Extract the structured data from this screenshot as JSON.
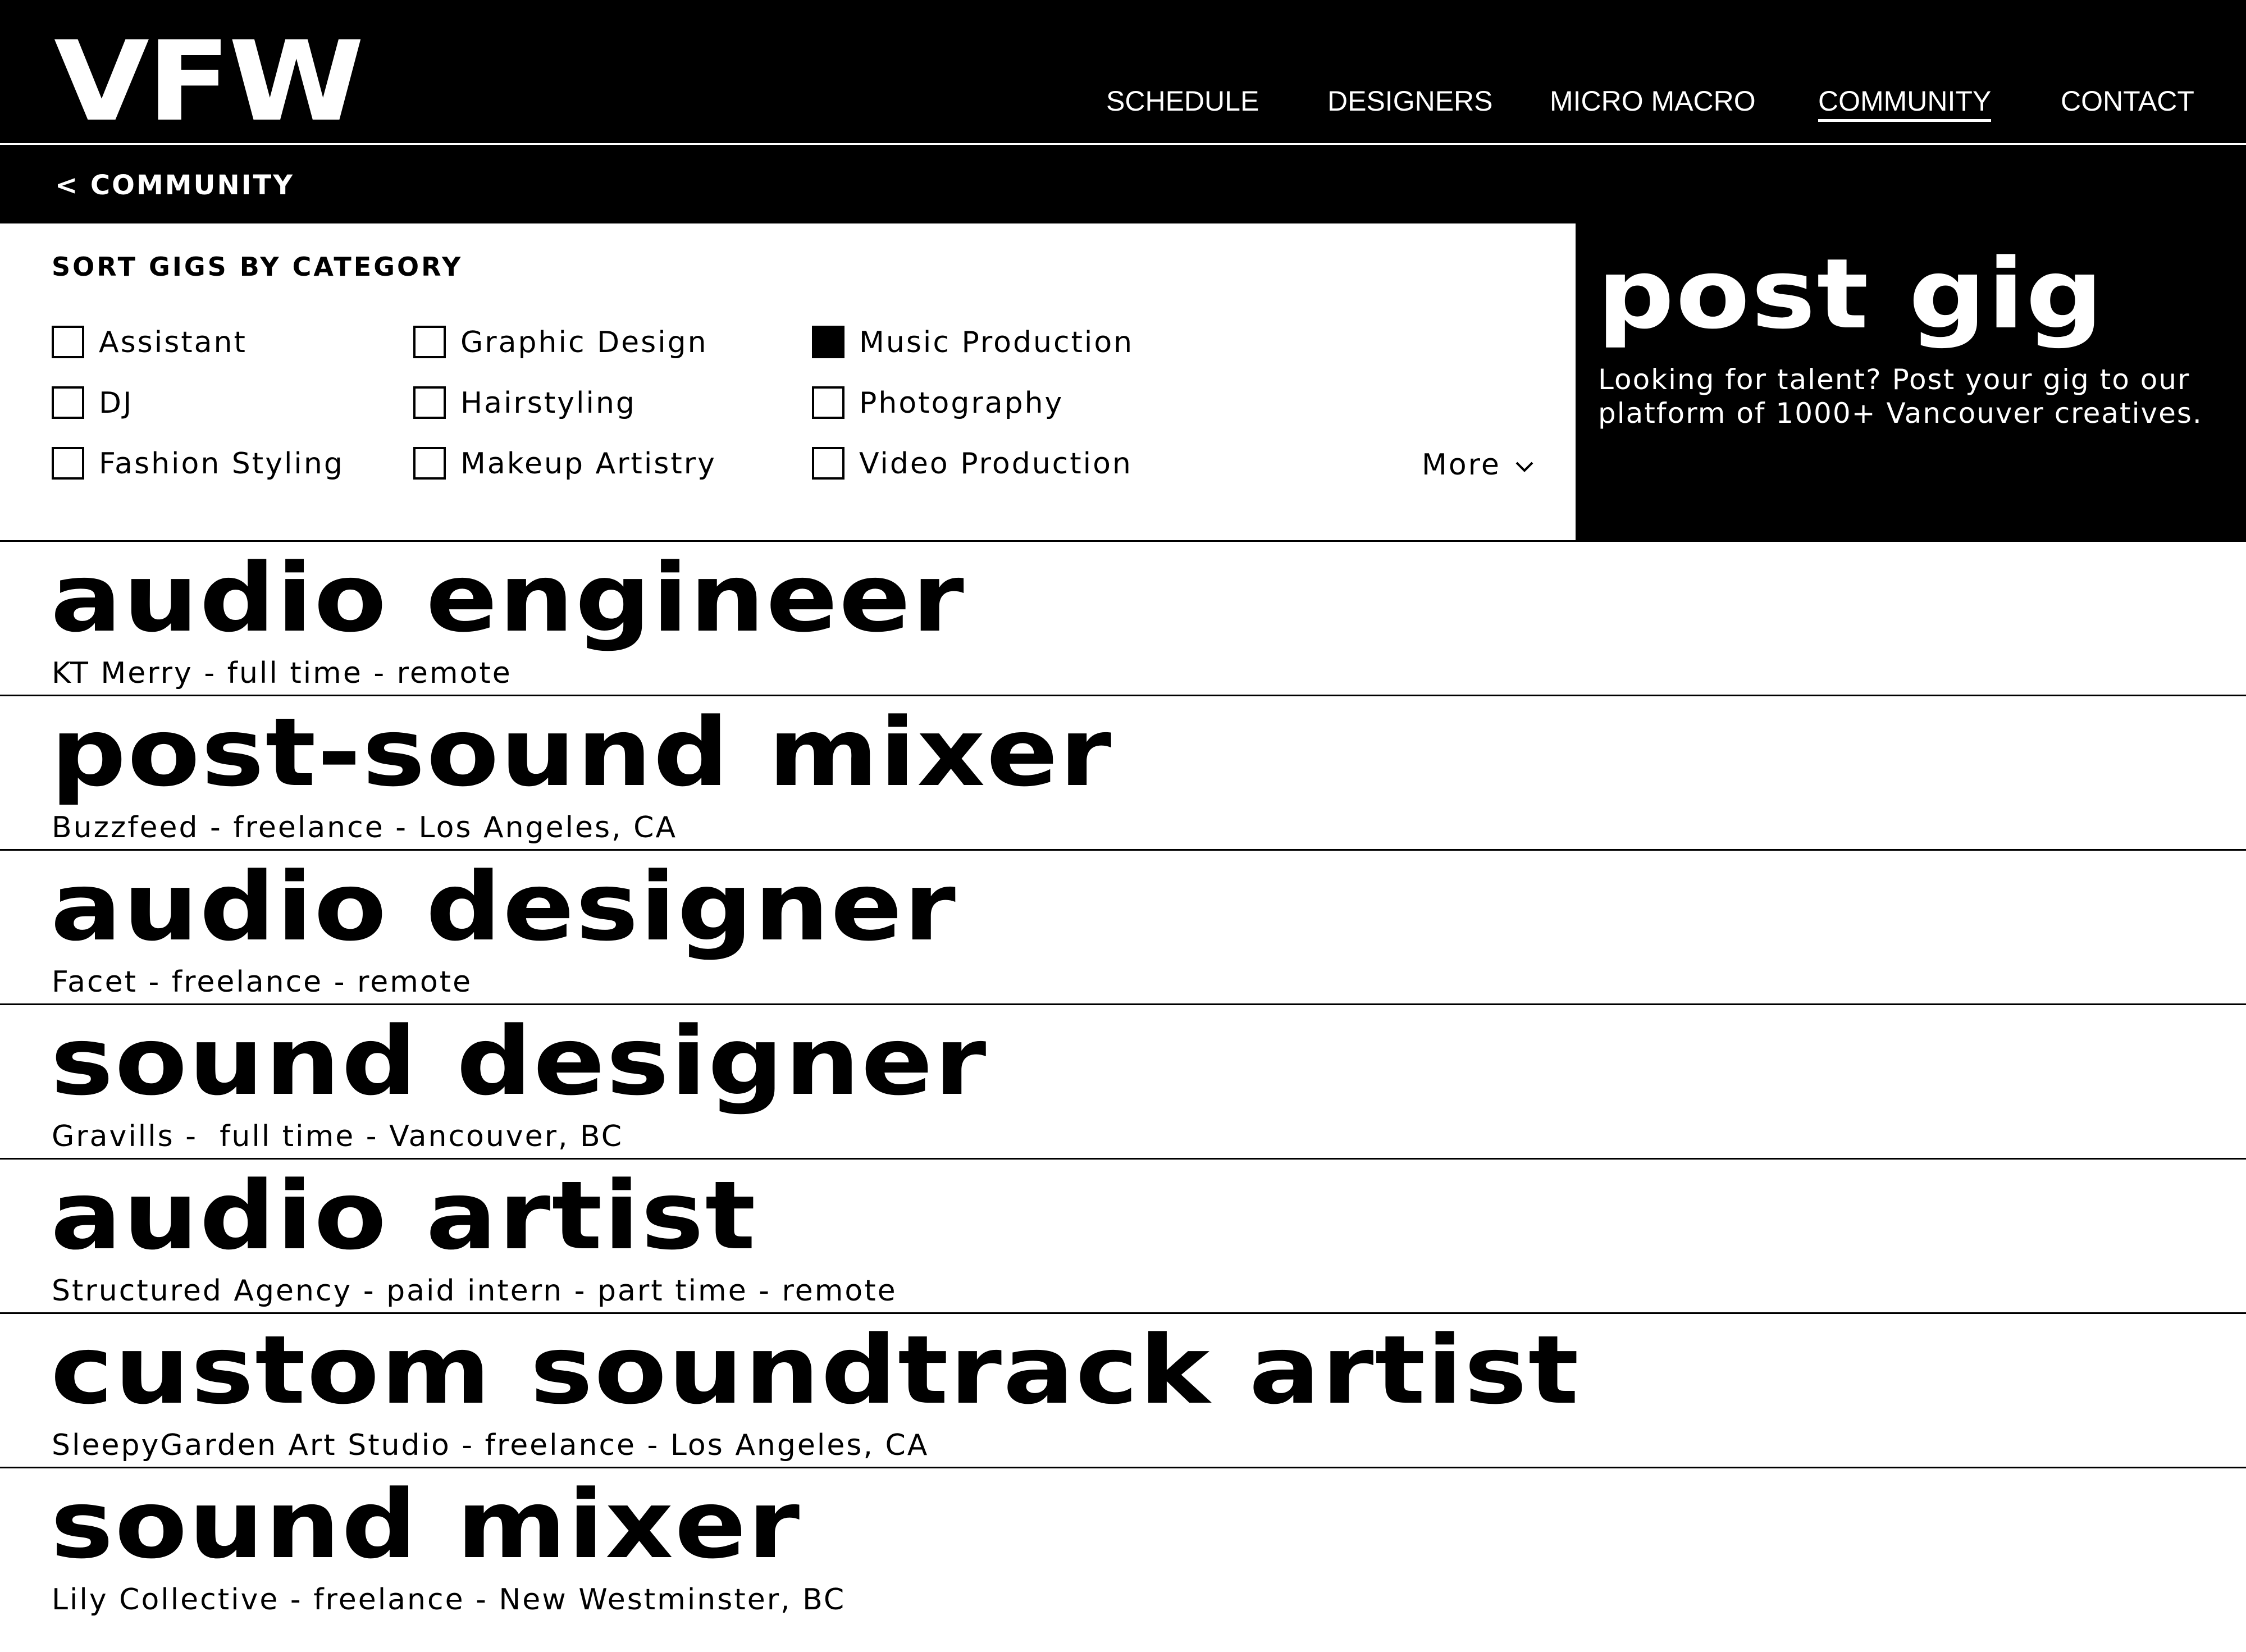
{
  "brand": {
    "logo": "VFW"
  },
  "nav": {
    "items": [
      {
        "label": "SCHEDULE",
        "active": false
      },
      {
        "label": "DESIGNERS",
        "active": false
      },
      {
        "label": "MICRO MACRO",
        "active": false
      },
      {
        "label": "COMMUNITY",
        "active": true
      },
      {
        "label": "CONTACT",
        "active": false
      }
    ]
  },
  "subbar": {
    "back_label": "< COMMUNITY"
  },
  "filters": {
    "title": "SORT GIGS BY CATEGORY",
    "categories": [
      {
        "label": "Assistant",
        "checked": false
      },
      {
        "label": "DJ",
        "checked": false
      },
      {
        "label": "Fashion Styling",
        "checked": false
      },
      {
        "label": "Graphic Design",
        "checked": false
      },
      {
        "label": "Hairstyling",
        "checked": false
      },
      {
        "label": "Makeup Artistry",
        "checked": false
      },
      {
        "label": "Music Production",
        "checked": true
      },
      {
        "label": "Photography",
        "checked": false
      },
      {
        "label": "Video Production",
        "checked": false
      }
    ],
    "more_label": "More",
    "more_icon": "chevron-down-icon"
  },
  "post_gig": {
    "title": "post gig",
    "description": "Looking for talent? Post your gig to our platform of 1000+ Vancouver creatives."
  },
  "gigs": [
    {
      "title": "audio engineer",
      "meta": "KT Merry - full time - remote"
    },
    {
      "title": "post-sound mixer",
      "meta": "Buzzfeed - freelance - Los Angeles, CA"
    },
    {
      "title": "audio designer",
      "meta": "Facet - freelance - remote"
    },
    {
      "title": "sound designer",
      "meta": "Gravills -  full time - Vancouver, BC"
    },
    {
      "title": "audio artist",
      "meta": "Structured Agency - paid intern - part time - remote"
    },
    {
      "title": "custom soundtrack artist",
      "meta": "SleepyGarden Art Studio - freelance - Los Angeles, CA"
    },
    {
      "title": "sound mixer",
      "meta": "Lily Collective - freelance - New Westminster, BC"
    }
  ],
  "colors": {
    "background": "#ffffff",
    "ink": "#000000",
    "inverse": "#ffffff"
  }
}
